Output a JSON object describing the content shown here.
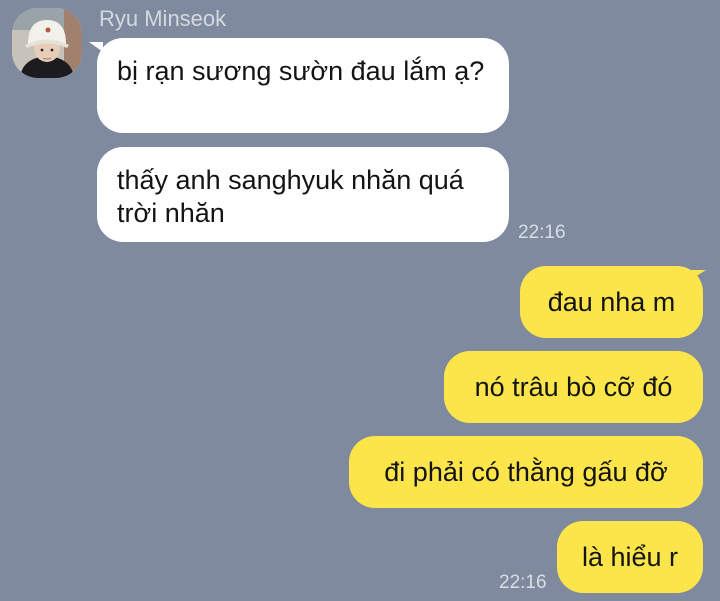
{
  "chat": {
    "sender_name": "Ryu Minseok",
    "incoming": [
      "bị rạn sương sườn đau lắm ạ?",
      "thấy anh sanghyuk nhăn quá trời nhăn"
    ],
    "incoming_time": "22:16",
    "outgoing": [
      "đau nha m",
      "nó trâu bò cỡ đó",
      "đi phải có thằng gấu đỡ",
      "là hiểu r"
    ],
    "outgoing_time": "22:16"
  },
  "colors": {
    "background": "#7f8a9e",
    "incoming_bubble": "#ffffff",
    "outgoing_bubble": "#fbe54a"
  },
  "icons": {
    "avatar": "profile-photo"
  }
}
